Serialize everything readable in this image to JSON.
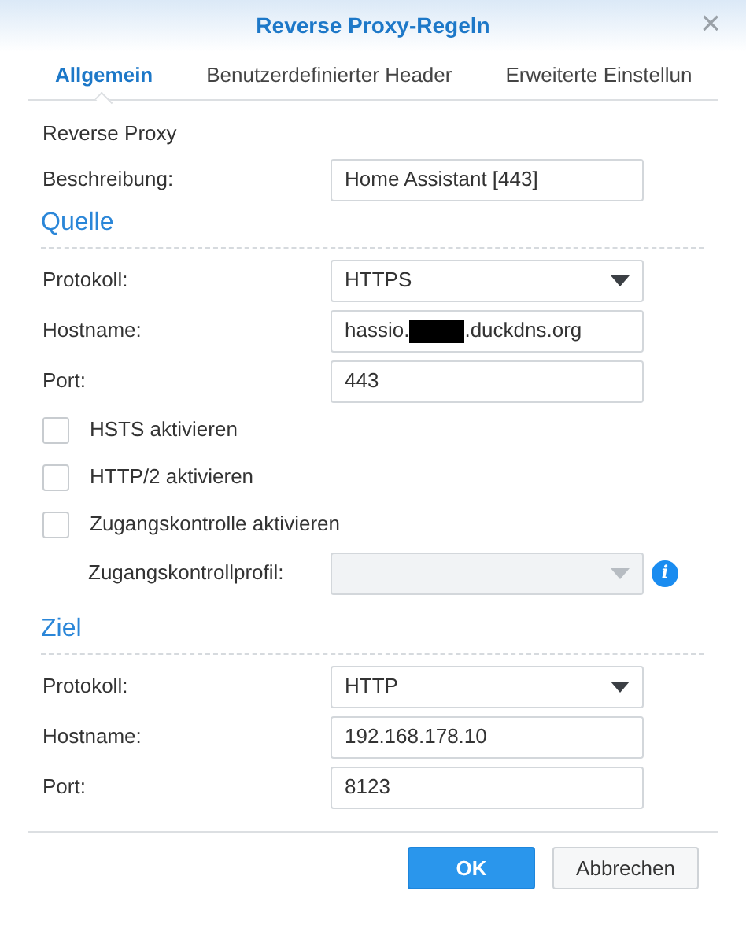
{
  "window": {
    "title": "Reverse Proxy-Regeln",
    "close": "×"
  },
  "tabs": [
    {
      "label": "Allgemein",
      "selected": true
    },
    {
      "label": "Benutzerdefinierter Header",
      "selected": false
    },
    {
      "label": "Erweiterte Einstellun",
      "selected": false
    }
  ],
  "intro": "Reverse Proxy",
  "description": {
    "label": "Beschreibung:",
    "value": "Home Assistant [443]"
  },
  "sections": [
    {
      "title": "Quelle",
      "rows": [
        {
          "kind": "select",
          "label": "Protokoll:",
          "value": "HTTPS",
          "disabled": false
        },
        {
          "kind": "text",
          "label": "Hostname:",
          "value": "hassio.",
          "redacted": true,
          "value_end": ".duckdns.org"
        },
        {
          "kind": "text",
          "label": "Port:",
          "value": "443"
        },
        {
          "kind": "checkbox",
          "label": "HSTS aktivieren",
          "checked": false
        },
        {
          "kind": "checkbox",
          "label": "HTTP/2 aktivieren",
          "checked": false
        },
        {
          "kind": "checkbox",
          "label": "Zugangskontrolle aktivieren",
          "checked": false
        },
        {
          "kind": "select",
          "label": "Zugangskontrollprofil:",
          "value": "",
          "disabled": true,
          "indented": true,
          "info": "i"
        }
      ]
    },
    {
      "title": "Ziel",
      "rows": [
        {
          "kind": "select",
          "label": "Protokoll:",
          "value": "HTTP",
          "disabled": false
        },
        {
          "kind": "text",
          "label": "Hostname:",
          "value": "192.168.178.10"
        },
        {
          "kind": "text",
          "label": "Port:",
          "value": "8123"
        }
      ]
    }
  ],
  "buttons": [
    {
      "label": "OK",
      "kind": "primary"
    },
    {
      "label": "Abbrechen",
      "kind": "secondary"
    }
  ]
}
